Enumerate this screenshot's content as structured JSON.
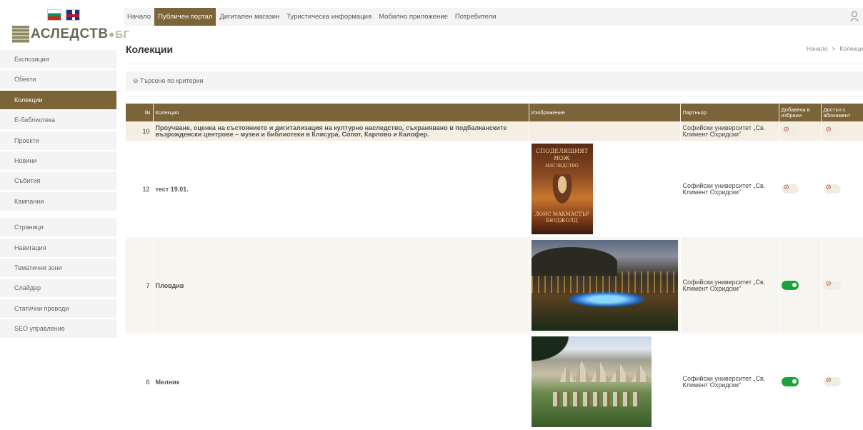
{
  "sidebar": {
    "logo_text": "АСЛЕДСТВ",
    "logo_suffix": "БГ",
    "items_top": [
      "Експозиции",
      "Обекти",
      "Колекции",
      "Е-библиотека",
      "Проекти",
      "Новини",
      "Събития",
      "Кампании"
    ],
    "items_bottom": [
      "Страници",
      "Навигация",
      "Тематични зони",
      "Слайдер",
      "Статични преводи",
      "SEO управление"
    ],
    "active": "Колекции"
  },
  "topnav": {
    "items": [
      "Начало",
      "Публичен портал",
      "Дигитален магазин",
      "Туристическа информация",
      "Мобилно приложение",
      "Потребители"
    ],
    "active": "Публичен портал"
  },
  "header": {
    "title": "Колекции",
    "breadcrumb_home": "Начало",
    "breadcrumb_sep": ">",
    "breadcrumb_current": "Колекци"
  },
  "search": {
    "label": "⊖ Търсене по критерии"
  },
  "table": {
    "headers": {
      "no": "№",
      "collection": "Колекция",
      "image": "Изображение",
      "partner": "Партньор",
      "favorites": "Добавена в избрани",
      "subscription": "Достъп с абонамент"
    },
    "rows": [
      {
        "no": "10",
        "collection": "Проучване, оценка на състоянието и дигитализация на културно наследство, съхранявано в подбалканските възрожденски центрове – музеи и библиотеки в Клисура, Сопот, Карлово и Калофер.",
        "image": "",
        "partner": "Софийски университет „Св. Климент Охридски“",
        "favorite": false,
        "subscription": false
      },
      {
        "no": "12",
        "collection": "тест 19.01.",
        "image": "book-cover",
        "book_title": "СПОДЕЛЯЩИЯТ НОЖ",
        "book_subtitle": "НАСЛЕДСТВО",
        "book_author": "ЛОИС МАКМАСТЪР БЮДЖОЛД",
        "partner": "Софийски университет „Св. Климент Охридски“",
        "favorite": false,
        "subscription": false
      },
      {
        "no": "7",
        "collection": "Пловдив",
        "image": "night-city",
        "partner": "Софийски университет „Св. Климент Охридски“",
        "favorite": true,
        "subscription": false
      },
      {
        "no": "6",
        "collection": "Мелник",
        "image": "mountain-town",
        "partner": "Софийски университет „Св. Климент Охридски“",
        "favorite": true,
        "subscription": false
      }
    ]
  },
  "colors": {
    "accent": "#7a6438",
    "toggle_on": "#1aa43a"
  }
}
